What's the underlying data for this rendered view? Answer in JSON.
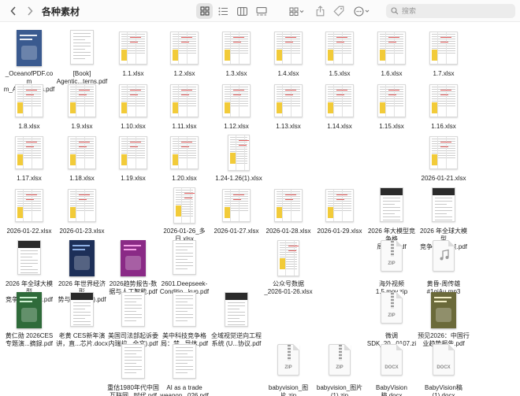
{
  "window": {
    "title": "各种素材",
    "search_placeholder": "搜索"
  },
  "colors": {
    "toolbar_bg": "#fbfbfb",
    "selected_view_bg": "#e4e4e4",
    "highlight_yellow": "#f2cb39",
    "sheet_red_text": "#e56060"
  },
  "toolbar_icons": [
    "chevron-left-icon",
    "chevron-right-icon",
    "icon-grid-view-icon",
    "list-view-icon",
    "column-view-icon",
    "gallery-view-icon",
    "group-by-icon",
    "share-icon",
    "tag-icon",
    "more-actions-icon",
    "search-icon"
  ],
  "files": [
    {
      "name": "_OceanofPDF.com\nm_Ange...anis.pdf",
      "kind": "pdf-cover-blue"
    },
    {
      "name": "[Book]\nAgentic...terns.pdf",
      "kind": "doc"
    },
    {
      "name": "1.1.xlsx",
      "kind": "xlsx"
    },
    {
      "name": "1.2.xlsx",
      "kind": "xlsx"
    },
    {
      "name": "1.3.xlsx",
      "kind": "xlsx"
    },
    {
      "name": "1.4.xlsx",
      "kind": "xlsx"
    },
    {
      "name": "1.5.xlsx",
      "kind": "xlsx"
    },
    {
      "name": "1.6.xlsx",
      "kind": "xlsx"
    },
    {
      "name": "1.7.xlsx",
      "kind": "xlsx"
    },
    {
      "name": "1.8.xlsx",
      "kind": "xlsx"
    },
    {
      "name": "1.9.xlsx",
      "kind": "xlsx"
    },
    {
      "name": "1.10.xlsx",
      "kind": "xlsx"
    },
    {
      "name": "1.11.xlsx",
      "kind": "xlsx"
    },
    {
      "name": "1.12.xlsx",
      "kind": "xlsx"
    },
    {
      "name": "1.13.xlsx",
      "kind": "xlsx"
    },
    {
      "name": "1.14.xlsx",
      "kind": "xlsx"
    },
    {
      "name": "1.15.xlsx",
      "kind": "xlsx"
    },
    {
      "name": "1.16.xlsx",
      "kind": "xlsx"
    },
    {
      "name": "1.17.xlsx",
      "kind": "xlsx"
    },
    {
      "name": "1.18.xlsx",
      "kind": "xlsx"
    },
    {
      "name": "1.19.xlsx",
      "kind": "xlsx"
    },
    {
      "name": "1.20.xlsx",
      "kind": "xlsx"
    },
    {
      "name": "1.24-1.26(1).xlsx",
      "kind": "xlsx-tall"
    },
    {
      "name": "2026-01-21.xlsx",
      "kind": "xlsx"
    },
    {
      "name": "2026-01-22.xlsx",
      "kind": "xlsx"
    },
    {
      "name": "2026-01-23.xlsx",
      "kind": "xlsx"
    },
    {
      "name": "2026-01-26_多\n日.xlsx",
      "kind": "xlsx-tall"
    },
    {
      "name": "2026-01-27.xlsx",
      "kind": "xlsx"
    },
    {
      "name": "2026-01-28.xlsx",
      "kind": "xlsx"
    },
    {
      "name": "2026-01-29.xlsx",
      "kind": "xlsx"
    },
    {
      "name": "2026 年大模型竞争格\n局研究.pdf",
      "kind": "doc-dark"
    },
    {
      "name": "2026 年全球大模型\n竞争格...折点.pdf",
      "kind": "doc-dark"
    },
    {
      "name": "2026 年全球大模型\n竞争格...分析.pdf",
      "kind": "doc-dark"
    },
    {
      "name": "2026 年世界经济形\n势与展望 (英).pdf",
      "kind": "pdf-cover-navy"
    },
    {
      "name": "2026趋势报告-数\n据与人工智能.pdf",
      "kind": "pdf-cover-magenta"
    },
    {
      "name": "2601.Deepseek-\nConditio...kup.pdf",
      "kind": "doc"
    },
    {
      "name": "公众号数据\n_2026-01-26.xlsx",
      "kind": "xlsx-tall"
    },
    {
      "name": "海外视频\n1.5.mov.zip",
      "kind": "zip"
    },
    {
      "name": "黄昏-周传雄\n#1qiAu.mp3",
      "kind": "mp3"
    },
    {
      "name": "黄仁勋 2026CES\n专题演...摘録.pdf",
      "kind": "pdf-cover-green"
    },
    {
      "name": "老黄 CES新年演\n讲，直...芯片.docx",
      "kind": "doc-dark"
    },
    {
      "name": "美国司法部起诉委\n内瑞拉...全文).pdf",
      "kind": "doc"
    },
    {
      "name": "美中科技竞争格\n局：禁...导体.pdf",
      "kind": "doc"
    },
    {
      "name": "全域视觉逆向工程\n系统 (U...协议.pdf",
      "kind": "doc-dark"
    },
    {
      "name": "微调\nSDK_20...0107.zip",
      "kind": "zip"
    },
    {
      "name": "预见2026：中国行\n业趋势报告.pdf",
      "kind": "pdf-cover-olive"
    },
    {
      "name": "重估1980年代中国\n互联网...时代.pdf",
      "kind": "doc"
    },
    {
      "name": "AI as a trade\nweapon...026.pdf",
      "kind": "doc"
    },
    {
      "name": "babyvision_图\n片.zip",
      "kind": "zip"
    },
    {
      "name": "babyvision_图片\n(1).zip",
      "kind": "zip"
    },
    {
      "name": "BabyVision\n稿.docx",
      "kind": "docx"
    },
    {
      "name": "BabyVision稿\n(1).docx",
      "kind": "docx"
    }
  ]
}
